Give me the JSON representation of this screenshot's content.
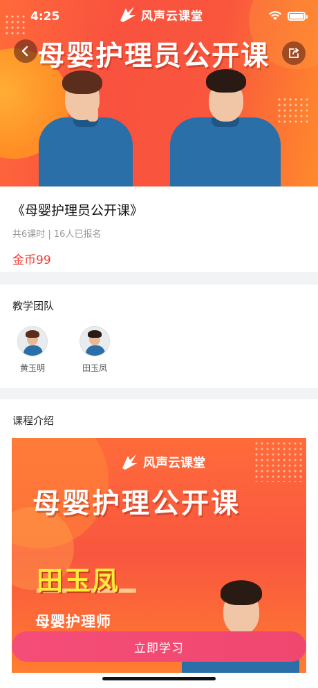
{
  "status_bar": {
    "time": "4:25"
  },
  "hero": {
    "brand": "风声云课堂",
    "title": "母婴护理员公开课"
  },
  "course": {
    "title": "《母婴护理员公开课》",
    "meta": "共6课时 | 16人已报名",
    "price": "金币99"
  },
  "team": {
    "heading": "教学团队",
    "teachers": [
      {
        "name": "黄玉明"
      },
      {
        "name": "田玉凤"
      }
    ]
  },
  "intro": {
    "heading": "课程介绍",
    "poster": {
      "brand": "风声云课堂",
      "title": "母婴护理公开课",
      "teacher_name": "田玉凤",
      "teacher_role": "母婴护理师"
    }
  },
  "cta": {
    "label": "立即学习"
  },
  "colors": {
    "accent": "#f03b34",
    "cta": "#f0476f",
    "hero": "#f9523f"
  },
  "icons": {
    "back": "chevron-left-icon",
    "share": "share-icon",
    "wifi": "wifi-icon",
    "battery": "battery-icon"
  }
}
